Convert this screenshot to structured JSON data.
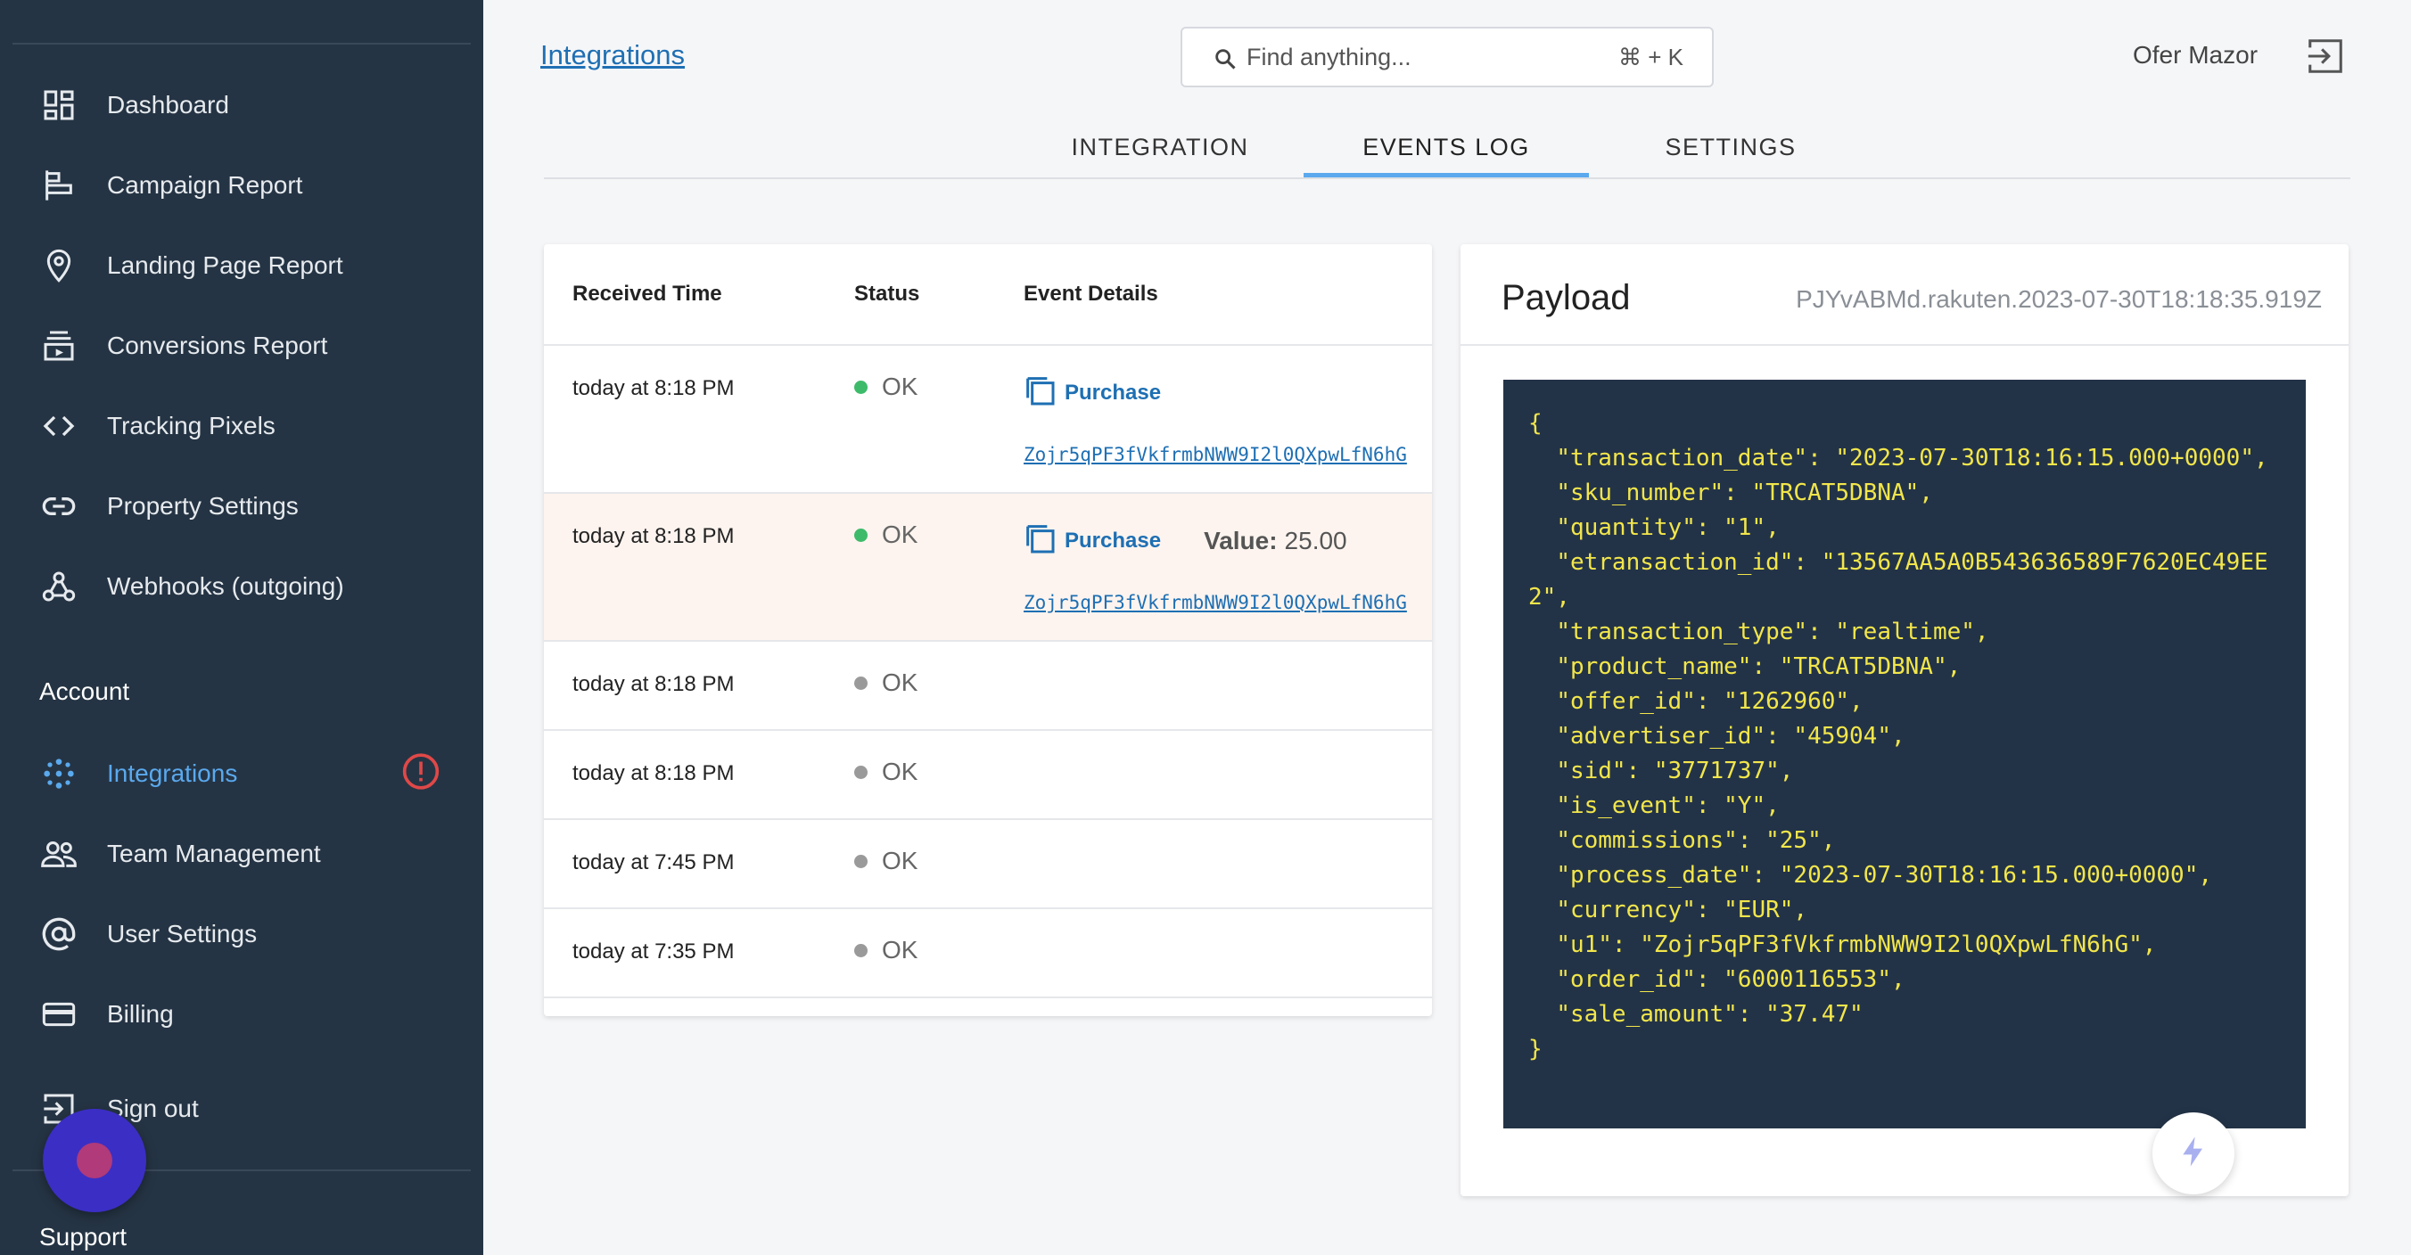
{
  "sidebar": {
    "items": [
      {
        "label": "Dashboard",
        "icon": "dashboard-icon"
      },
      {
        "label": "Campaign Report",
        "icon": "campaign-icon"
      },
      {
        "label": "Landing Page Report",
        "icon": "location-pin-icon"
      },
      {
        "label": "Conversions Report",
        "icon": "conversions-icon"
      },
      {
        "label": "Tracking Pixels",
        "icon": "code-icon"
      },
      {
        "label": "Property Settings",
        "icon": "link-icon"
      },
      {
        "label": "Webhooks (outgoing)",
        "icon": "webhook-icon"
      }
    ],
    "account_title": "Account",
    "account_items": [
      {
        "label": "Integrations",
        "icon": "integrations-icon",
        "active": true,
        "alert": true
      },
      {
        "label": "Team Management",
        "icon": "team-icon"
      },
      {
        "label": "User Settings",
        "icon": "at-icon"
      },
      {
        "label": "Billing",
        "icon": "credit-card-icon"
      },
      {
        "label": "Sign out",
        "icon": "sign-out-icon"
      }
    ],
    "support_title": "Support"
  },
  "header": {
    "breadcrumb": "Integrations",
    "search_placeholder": "Find anything...",
    "search_shortcut": "⌘ + K",
    "user_name": "Ofer Mazor"
  },
  "tabs": [
    {
      "label": "INTEGRATION",
      "active": false
    },
    {
      "label": "EVENTS LOG",
      "active": true
    },
    {
      "label": "SETTINGS",
      "active": false
    }
  ],
  "events": {
    "headers": [
      "Received Time",
      "Status",
      "Event Details"
    ],
    "rows": [
      {
        "time": "today at 8:18 PM",
        "status": "OK",
        "status_color": "#3dbb6a",
        "event": "Purchase",
        "value_label": "",
        "value": "",
        "transaction": "Zojr5qPF3fVkfrmbNWW9I2l0QXpwLfN6hG",
        "highlighted": false
      },
      {
        "time": "today at 8:18 PM",
        "status": "OK",
        "status_color": "#3dbb6a",
        "event": "Purchase",
        "value_label": "Value:",
        "value": "25.00",
        "transaction": "Zojr5qPF3fVkfrmbNWW9I2l0QXpwLfN6hG",
        "highlighted": true
      },
      {
        "time": "today at 8:18 PM",
        "status": "OK",
        "status_color": "#9a9a9a"
      },
      {
        "time": "today at 8:18 PM",
        "status": "OK",
        "status_color": "#9a9a9a"
      },
      {
        "time": "today at 7:45 PM",
        "status": "OK",
        "status_color": "#9a9a9a"
      },
      {
        "time": "today at 7:35 PM",
        "status": "OK",
        "status_color": "#9a9a9a"
      }
    ]
  },
  "payload": {
    "title": "Payload",
    "id": "PJYvABMd.rakuten.2023-07-30T18:18:35.919Z",
    "code": "{\n  \"transaction_date\": \"2023-07-30T18:16:15.000+0000\",\n  \"sku_number\": \"TRCAT5DBNA\",\n  \"quantity\": \"1\",\n  \"etransaction_id\": \"13567AA5A0B543636589F7620EC49EE2\",\n  \"transaction_type\": \"realtime\",\n  \"product_name\": \"TRCAT5DBNA\",\n  \"offer_id\": \"1262960\",\n  \"advertiser_id\": \"45904\",\n  \"sid\": \"3771737\",\n  \"is_event\": \"Y\",\n  \"commissions\": \"25\",\n  \"process_date\": \"2023-07-30T18:16:15.000+0000\",\n  \"currency\": \"EUR\",\n  \"u1\": \"Zojr5qPF3fVkfrmbNWW9I2l0QXpwLfN6hG\",\n  \"order_id\": \"6000116553\",\n  \"sale_amount\": \"37.47\"\n}"
  }
}
